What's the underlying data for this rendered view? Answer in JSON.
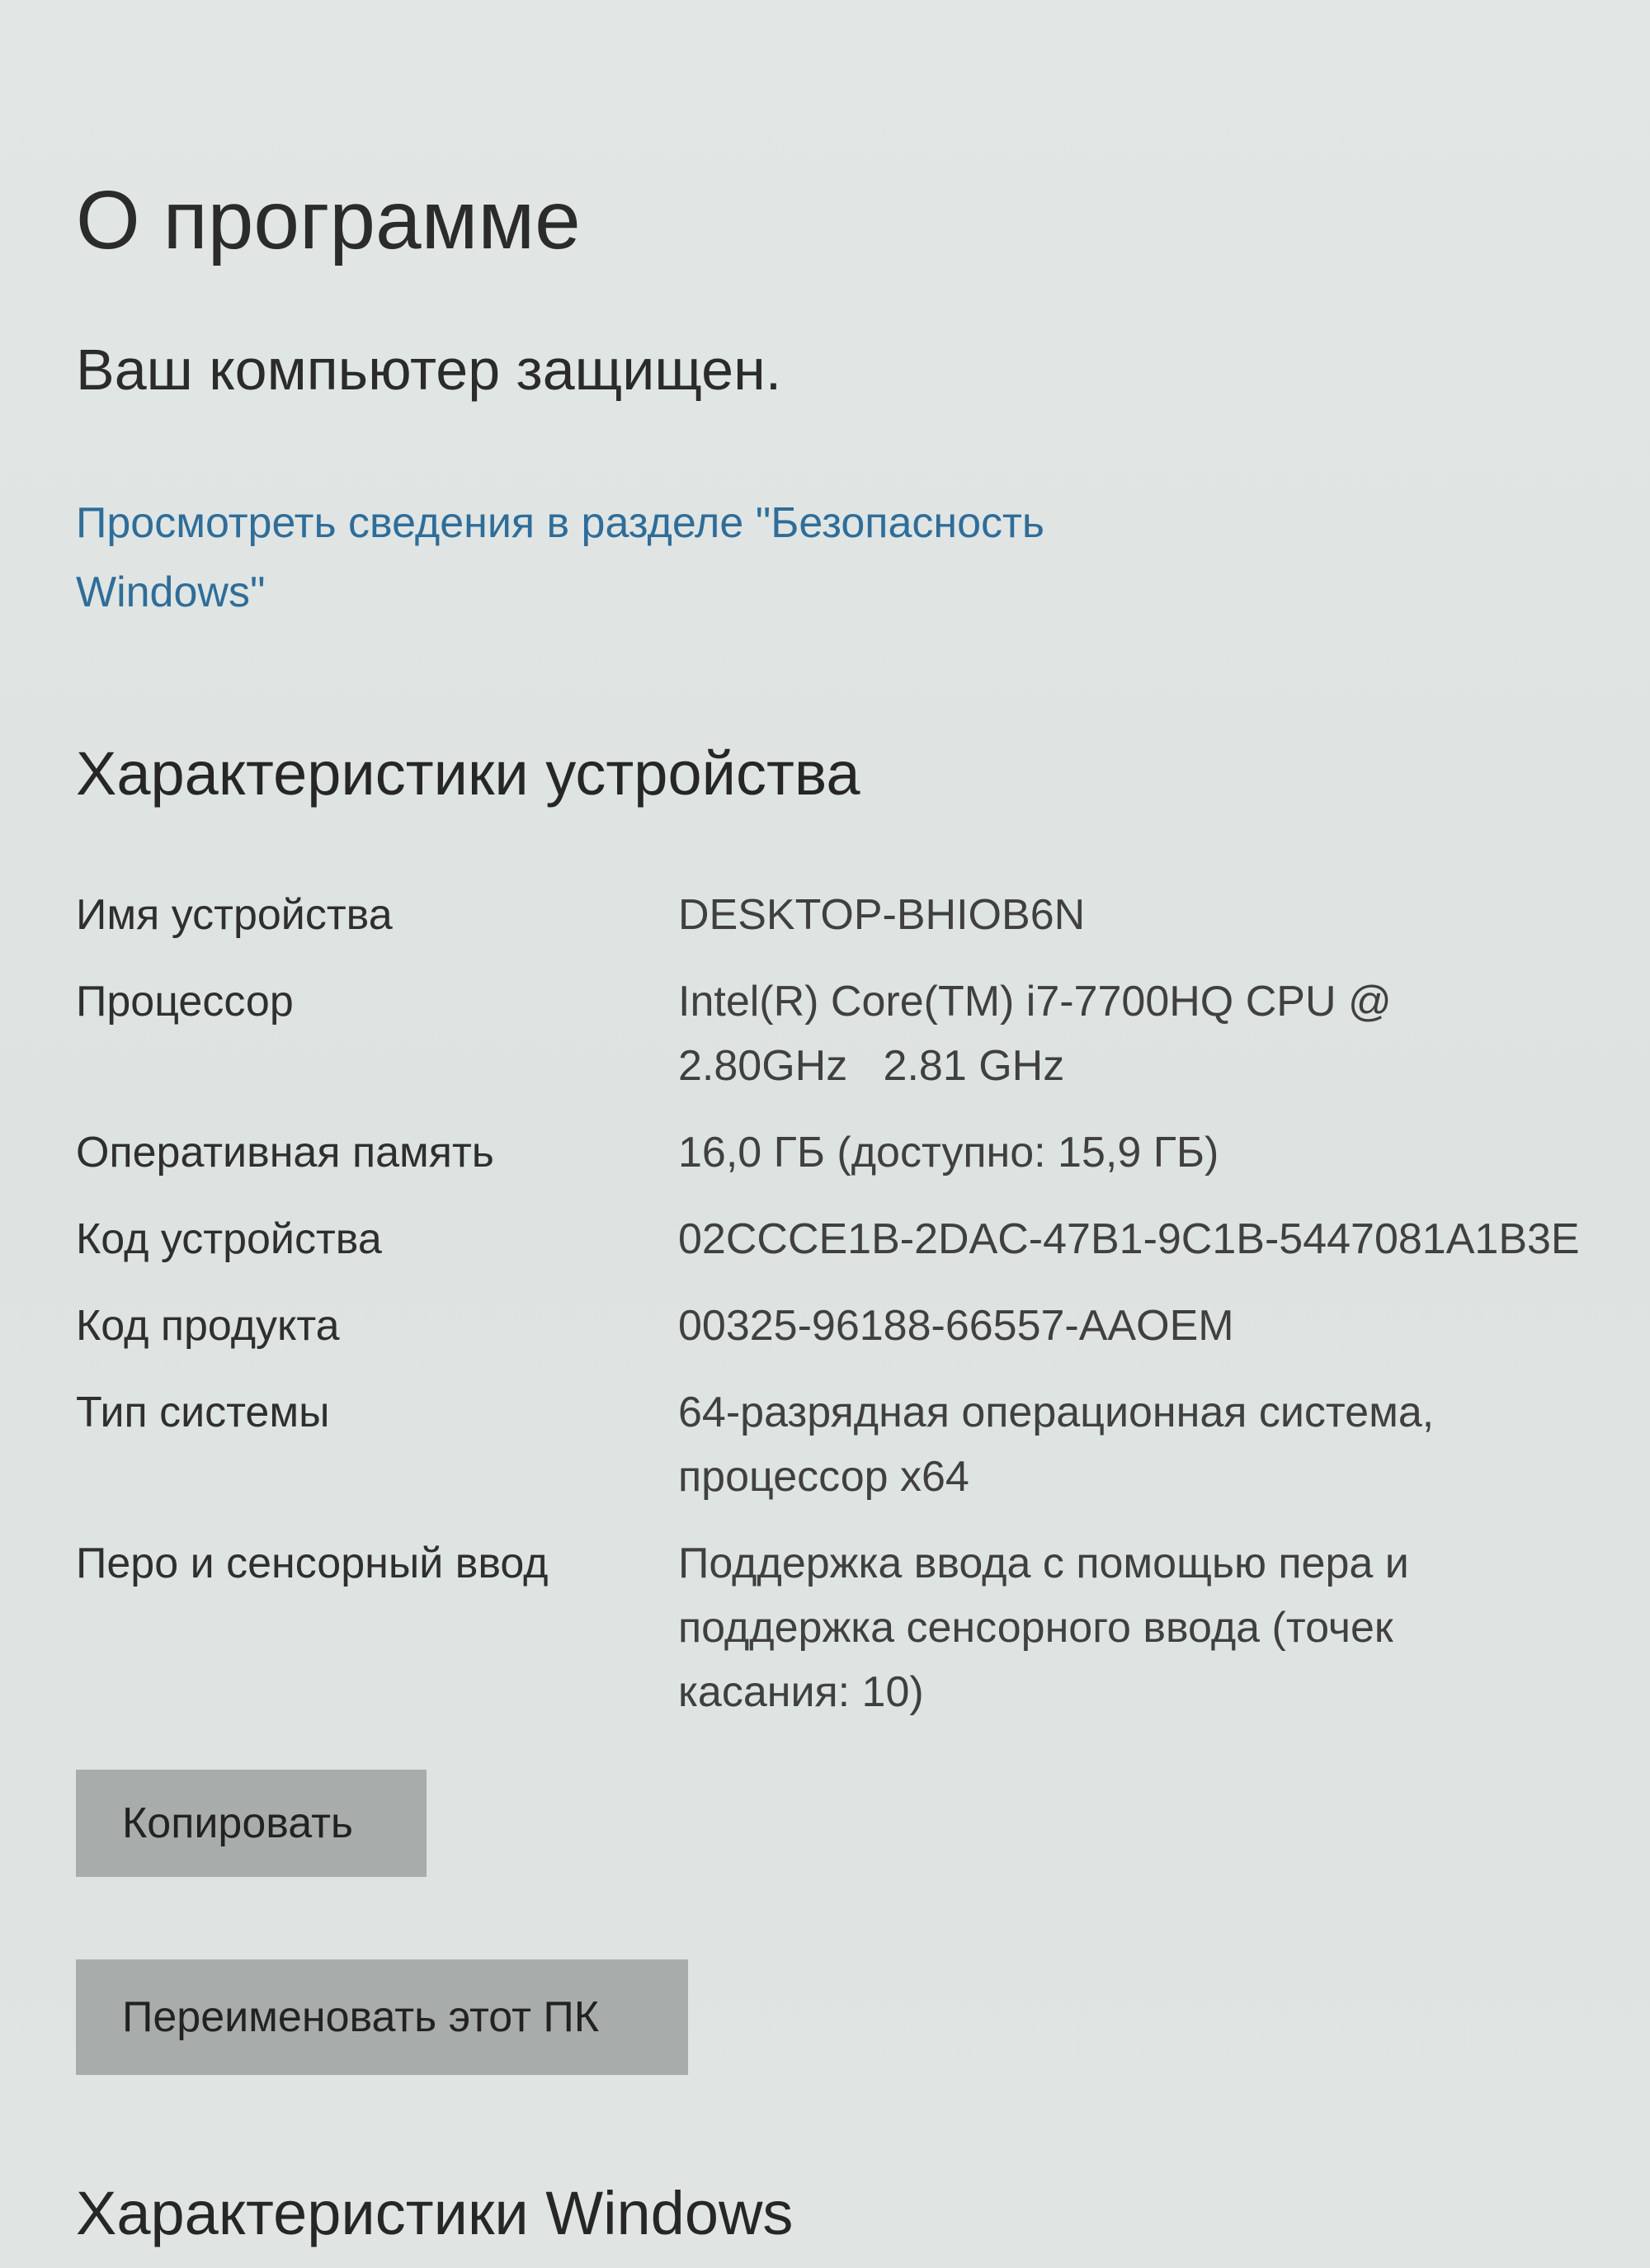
{
  "page": {
    "title": "О программе"
  },
  "security": {
    "status": "Ваш компьютер защищен.",
    "link_text": "Просмотреть сведения в разделе \"Безопасность Windows\""
  },
  "device_specs": {
    "title": "Характеристики устройства",
    "rows": [
      {
        "label": "Имя устройства",
        "value": "DESKTOP-BHIOB6N"
      },
      {
        "label": "Процессор",
        "value": "Intel(R) Core(TM) i7-7700HQ CPU @ 2.80GHz   2.81 GHz"
      },
      {
        "label": "Оперативная память",
        "value": "16,0 ГБ (доступно: 15,9 ГБ)"
      },
      {
        "label": "Код устройства",
        "value": "02CCCE1B-2DAC-47B1-9C1B-5447081A1B3E"
      },
      {
        "label": "Код продукта",
        "value": "00325-96188-66557-AAOEM"
      },
      {
        "label": "Тип системы",
        "value": "64-разрядная операционная система, процессор x64"
      },
      {
        "label": "Перо и сенсорный ввод",
        "value": "Поддержка ввода с помощью пера и поддержка сенсорного ввода (точек касания: 10)"
      }
    ],
    "copy_button": "Копировать",
    "rename_button": "Переименовать этот ПК"
  },
  "windows_specs": {
    "title": "Характеристики Windows"
  }
}
